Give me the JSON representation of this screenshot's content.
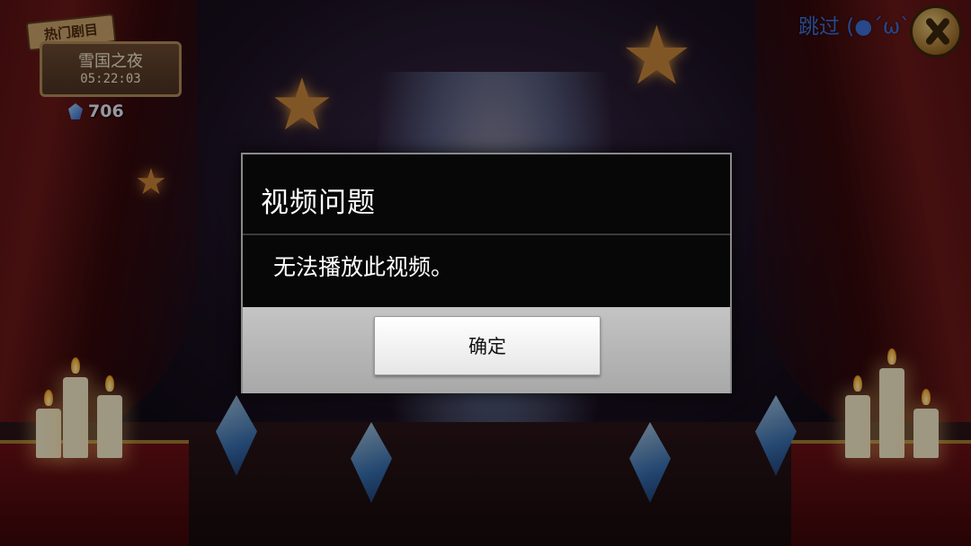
{
  "hud": {
    "event_tag": "热门剧目",
    "event_name": "雪国之夜",
    "event_timer": "05:22:03",
    "gem_count": "706",
    "skip_label": "跳过 (●´ω`●)"
  },
  "dialog": {
    "title": "视频问题",
    "message": "无法播放此视频。",
    "ok_label": "确定"
  },
  "colors": {
    "skip_text": "#3d6fd4",
    "dialog_bg": "#070707",
    "dialog_footer": "#b8b8b8"
  },
  "icons": {
    "gem": "gem-icon",
    "skip": "skip-icon"
  }
}
